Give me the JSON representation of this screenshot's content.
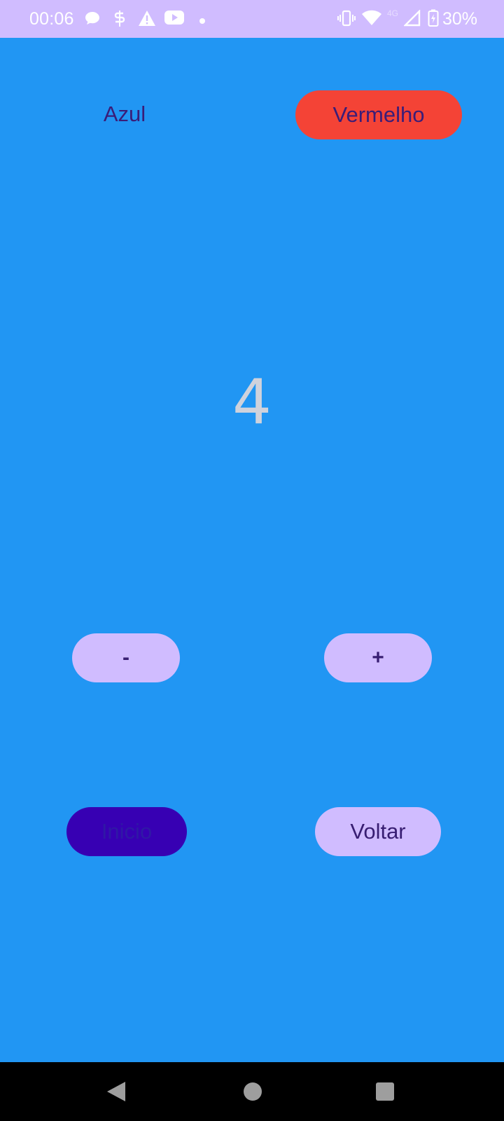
{
  "status_bar": {
    "time": "00:06",
    "network_label": "4G",
    "battery_percent": "30%",
    "icons": [
      "chat-bubble-icon",
      "s-notification-icon",
      "warning-icon",
      "youtube-icon",
      "dot-icon",
      "vibrate-icon",
      "wifi-icon",
      "signal-icon",
      "battery-charging-icon"
    ]
  },
  "app": {
    "background_color": "#2196f3",
    "top_buttons": {
      "azul_label": "Azul",
      "vermelho_label": "Vermelho",
      "vermelho_color": "#f44336"
    },
    "counter_value": "4",
    "stepper": {
      "minus_label": "-",
      "plus_label": "+"
    },
    "bottom_buttons": {
      "inicio_label": "Inicio",
      "inicio_color": "#3700b3",
      "voltar_label": "Voltar"
    },
    "accent_color": "#d0bcff",
    "text_color": "#381e72"
  },
  "nav_bar": {
    "icons": [
      "back-icon",
      "home-icon",
      "recents-icon"
    ]
  }
}
